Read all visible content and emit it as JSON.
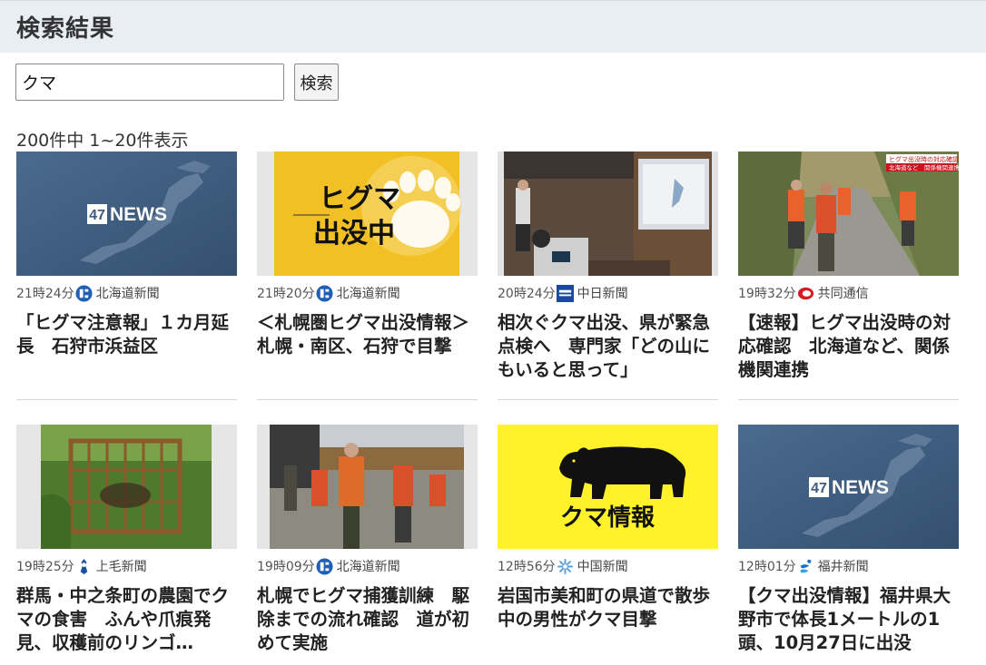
{
  "header": {
    "title": "検索結果"
  },
  "search": {
    "query": "クマ",
    "button_label": "検索"
  },
  "results": {
    "count_text": "200件中 1~20件表示"
  },
  "cards": [
    {
      "time": "21時24分",
      "source": "北海道新聞",
      "logo": "hokkaido-shimbun-logo-icon",
      "title": "「ヒグマ注意報」１カ月延長　石狩市浜益区",
      "thumb": {
        "kind": "47news",
        "text": "47NEWS"
      }
    },
    {
      "time": "21時20分",
      "source": "北海道新聞",
      "logo": "hokkaido-shimbun-logo-icon",
      "title": "＜札幌圏ヒグマ出没情報＞札幌・南区、石狩で目撃",
      "thumb": {
        "kind": "higuma",
        "text": "ヒグマ出没中"
      }
    },
    {
      "time": "20時24分",
      "source": "中日新聞",
      "logo": "chunichi-shimbun-logo-icon",
      "title": "相次ぐクマ出没、県が緊急点検へ　専門家「どの山にもいると思って」",
      "thumb": {
        "kind": "lecture"
      }
    },
    {
      "time": "19時32分",
      "source": "共同通信",
      "logo": "kyodo-news-logo-icon",
      "title": "【速報】ヒグマ出没時の対応確認　北海道など、関係機関連携",
      "thumb": {
        "kind": "hunters",
        "caption1": "ヒグマ出没時の対応確認",
        "caption2": "北海道など　関係機関連携"
      }
    },
    {
      "time": "19時25分",
      "source": "上毛新聞",
      "logo": "jomo-shimbun-logo-icon",
      "title": "群馬・中之条町の農園でクマの食害　ふんや爪痕発見、収穫前のリンゴ…",
      "thumb": {
        "kind": "trap"
      }
    },
    {
      "time": "19時09分",
      "source": "北海道新聞",
      "logo": "hokkaido-shimbun-logo-icon",
      "title": "札幌でヒグマ捕獲訓練　駆除までの流れ確認　道が初めて実施",
      "thumb": {
        "kind": "training"
      }
    },
    {
      "time": "12時56分",
      "source": "中国新聞",
      "logo": "chugoku-shimbun-logo-icon",
      "title": "岩国市美和町の県道で散歩中の男性がクマ目撃",
      "thumb": {
        "kind": "kuma",
        "text": "クマ情報"
      }
    },
    {
      "time": "12時01分",
      "source": "福井新聞",
      "logo": "fukui-shimbun-logo-icon",
      "title": "【クマ出没情報】福井県大野市で体長1メートルの1頭、10月27日に出没",
      "thumb": {
        "kind": "47news",
        "text": "47NEWS"
      }
    }
  ],
  "colors": {
    "header_bg": "#e9eef4",
    "news47_bg": "#3f5c7e",
    "higuma_bg": "#f2c025",
    "kuma_bg": "#fff12a"
  }
}
